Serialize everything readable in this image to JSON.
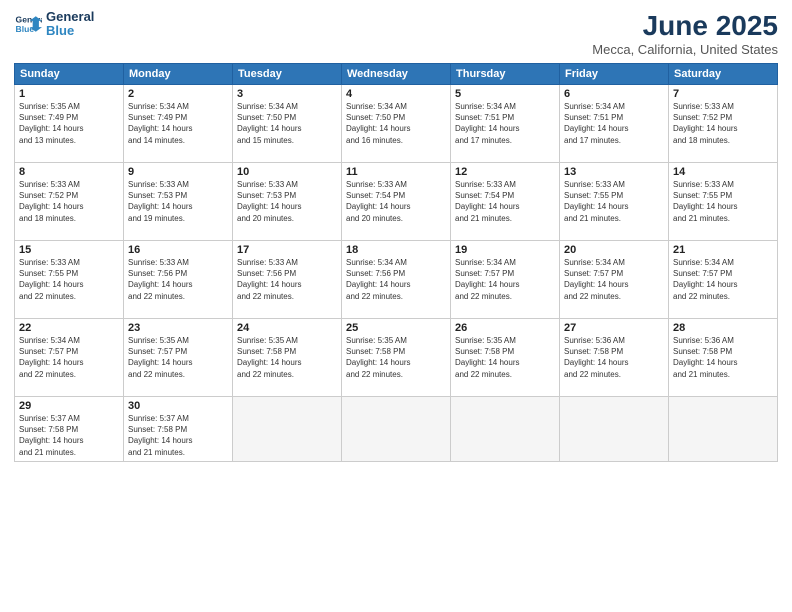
{
  "logo": {
    "line1": "General",
    "line2": "Blue"
  },
  "title": "June 2025",
  "subtitle": "Mecca, California, United States",
  "days_of_week": [
    "Sunday",
    "Monday",
    "Tuesday",
    "Wednesday",
    "Thursday",
    "Friday",
    "Saturday"
  ],
  "weeks": [
    [
      {
        "day": "1",
        "info": "Sunrise: 5:35 AM\nSunset: 7:49 PM\nDaylight: 14 hours\nand 13 minutes."
      },
      {
        "day": "2",
        "info": "Sunrise: 5:34 AM\nSunset: 7:49 PM\nDaylight: 14 hours\nand 14 minutes."
      },
      {
        "day": "3",
        "info": "Sunrise: 5:34 AM\nSunset: 7:50 PM\nDaylight: 14 hours\nand 15 minutes."
      },
      {
        "day": "4",
        "info": "Sunrise: 5:34 AM\nSunset: 7:50 PM\nDaylight: 14 hours\nand 16 minutes."
      },
      {
        "day": "5",
        "info": "Sunrise: 5:34 AM\nSunset: 7:51 PM\nDaylight: 14 hours\nand 17 minutes."
      },
      {
        "day": "6",
        "info": "Sunrise: 5:34 AM\nSunset: 7:51 PM\nDaylight: 14 hours\nand 17 minutes."
      },
      {
        "day": "7",
        "info": "Sunrise: 5:33 AM\nSunset: 7:52 PM\nDaylight: 14 hours\nand 18 minutes."
      }
    ],
    [
      {
        "day": "8",
        "info": "Sunrise: 5:33 AM\nSunset: 7:52 PM\nDaylight: 14 hours\nand 18 minutes."
      },
      {
        "day": "9",
        "info": "Sunrise: 5:33 AM\nSunset: 7:53 PM\nDaylight: 14 hours\nand 19 minutes."
      },
      {
        "day": "10",
        "info": "Sunrise: 5:33 AM\nSunset: 7:53 PM\nDaylight: 14 hours\nand 20 minutes."
      },
      {
        "day": "11",
        "info": "Sunrise: 5:33 AM\nSunset: 7:54 PM\nDaylight: 14 hours\nand 20 minutes."
      },
      {
        "day": "12",
        "info": "Sunrise: 5:33 AM\nSunset: 7:54 PM\nDaylight: 14 hours\nand 21 minutes."
      },
      {
        "day": "13",
        "info": "Sunrise: 5:33 AM\nSunset: 7:55 PM\nDaylight: 14 hours\nand 21 minutes."
      },
      {
        "day": "14",
        "info": "Sunrise: 5:33 AM\nSunset: 7:55 PM\nDaylight: 14 hours\nand 21 minutes."
      }
    ],
    [
      {
        "day": "15",
        "info": "Sunrise: 5:33 AM\nSunset: 7:55 PM\nDaylight: 14 hours\nand 22 minutes."
      },
      {
        "day": "16",
        "info": "Sunrise: 5:33 AM\nSunset: 7:56 PM\nDaylight: 14 hours\nand 22 minutes."
      },
      {
        "day": "17",
        "info": "Sunrise: 5:33 AM\nSunset: 7:56 PM\nDaylight: 14 hours\nand 22 minutes."
      },
      {
        "day": "18",
        "info": "Sunrise: 5:34 AM\nSunset: 7:56 PM\nDaylight: 14 hours\nand 22 minutes."
      },
      {
        "day": "19",
        "info": "Sunrise: 5:34 AM\nSunset: 7:57 PM\nDaylight: 14 hours\nand 22 minutes."
      },
      {
        "day": "20",
        "info": "Sunrise: 5:34 AM\nSunset: 7:57 PM\nDaylight: 14 hours\nand 22 minutes."
      },
      {
        "day": "21",
        "info": "Sunrise: 5:34 AM\nSunset: 7:57 PM\nDaylight: 14 hours\nand 22 minutes."
      }
    ],
    [
      {
        "day": "22",
        "info": "Sunrise: 5:34 AM\nSunset: 7:57 PM\nDaylight: 14 hours\nand 22 minutes."
      },
      {
        "day": "23",
        "info": "Sunrise: 5:35 AM\nSunset: 7:57 PM\nDaylight: 14 hours\nand 22 minutes."
      },
      {
        "day": "24",
        "info": "Sunrise: 5:35 AM\nSunset: 7:58 PM\nDaylight: 14 hours\nand 22 minutes."
      },
      {
        "day": "25",
        "info": "Sunrise: 5:35 AM\nSunset: 7:58 PM\nDaylight: 14 hours\nand 22 minutes."
      },
      {
        "day": "26",
        "info": "Sunrise: 5:35 AM\nSunset: 7:58 PM\nDaylight: 14 hours\nand 22 minutes."
      },
      {
        "day": "27",
        "info": "Sunrise: 5:36 AM\nSunset: 7:58 PM\nDaylight: 14 hours\nand 22 minutes."
      },
      {
        "day": "28",
        "info": "Sunrise: 5:36 AM\nSunset: 7:58 PM\nDaylight: 14 hours\nand 21 minutes."
      }
    ],
    [
      {
        "day": "29",
        "info": "Sunrise: 5:37 AM\nSunset: 7:58 PM\nDaylight: 14 hours\nand 21 minutes."
      },
      {
        "day": "30",
        "info": "Sunrise: 5:37 AM\nSunset: 7:58 PM\nDaylight: 14 hours\nand 21 minutes."
      },
      {
        "day": "",
        "info": ""
      },
      {
        "day": "",
        "info": ""
      },
      {
        "day": "",
        "info": ""
      },
      {
        "day": "",
        "info": ""
      },
      {
        "day": "",
        "info": ""
      }
    ]
  ]
}
